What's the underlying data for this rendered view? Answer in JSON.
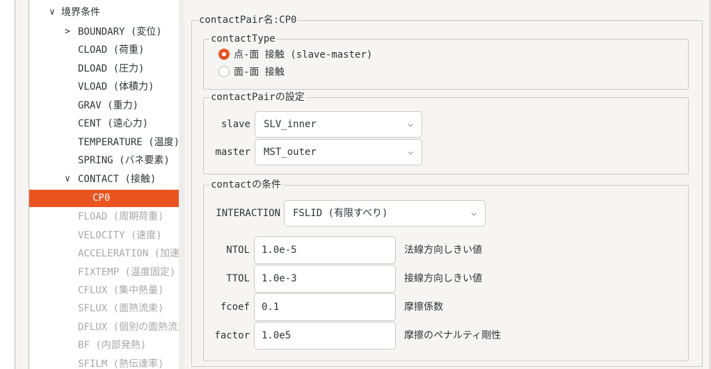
{
  "tree": {
    "rows": [
      {
        "label": "境界条件",
        "expander": "∨"
      },
      {
        "label": "BOUNDARY (変位)",
        "expander": ">"
      },
      {
        "label": "CLOAD (荷重)"
      },
      {
        "label": "DLOAD (圧力)"
      },
      {
        "label": "VLOAD (体積力)"
      },
      {
        "label": "GRAV (重力)"
      },
      {
        "label": "CENT (遠心力)"
      },
      {
        "label": "TEMPERATURE (温度)"
      },
      {
        "label": "SPRING (バネ要素)"
      },
      {
        "label": "CONTACT (接触)",
        "expander": "∨"
      },
      {
        "label": "CP0"
      },
      {
        "label": "FLOAD (周期荷重)"
      },
      {
        "label": "VELOCITY (速度)"
      },
      {
        "label": "ACCELERATION (加速度)"
      },
      {
        "label": "FIXTEMP (温度固定)"
      },
      {
        "label": "CFLUX (集中熱量)"
      },
      {
        "label": "SFLUX (面熱流束)"
      },
      {
        "label": "DFLUX (個別の面熱流束)"
      },
      {
        "label": "BF (内部発熱)"
      },
      {
        "label": "SFILM (熱伝達率)"
      }
    ]
  },
  "content": {
    "pair_title": "contactPair名:CP0",
    "contact_type": {
      "title": "contactType",
      "options": [
        "点-面 接触 (slave-master)",
        "面-面 接触"
      ],
      "selected_index": 0
    },
    "pair_settings": {
      "title": "contactPairの設定",
      "slave_label": "slave",
      "slave_value": "SLV_inner",
      "master_label": "master",
      "master_value": "MST_outer"
    },
    "conditions": {
      "title": "contactの条件",
      "interaction_label": "INTERACTION",
      "interaction_value": "FSLID (有限すべり)",
      "params": [
        {
          "label": "NTOL",
          "value": "1.0e-5",
          "note": "法線方向しきい値"
        },
        {
          "label": "TTOL",
          "value": "1.0e-3",
          "note": "接線方向しきい値"
        },
        {
          "label": "fcoef",
          "value": "0.1",
          "note": "摩擦係数"
        },
        {
          "label": "factor",
          "value": "1.0e5",
          "note": "摩擦のペナルティ剛性"
        }
      ]
    }
  },
  "icons": {
    "dropdown": "chevron-down-icon",
    "tree_collapse": "chevron-down-icon",
    "tree_expand": "chevron-right-icon"
  },
  "colors": {
    "accent": "#e95420",
    "selected_text": "#ffffff",
    "dimmed_text": "#a7a7a7",
    "window_bg": "#f6f5f4"
  }
}
